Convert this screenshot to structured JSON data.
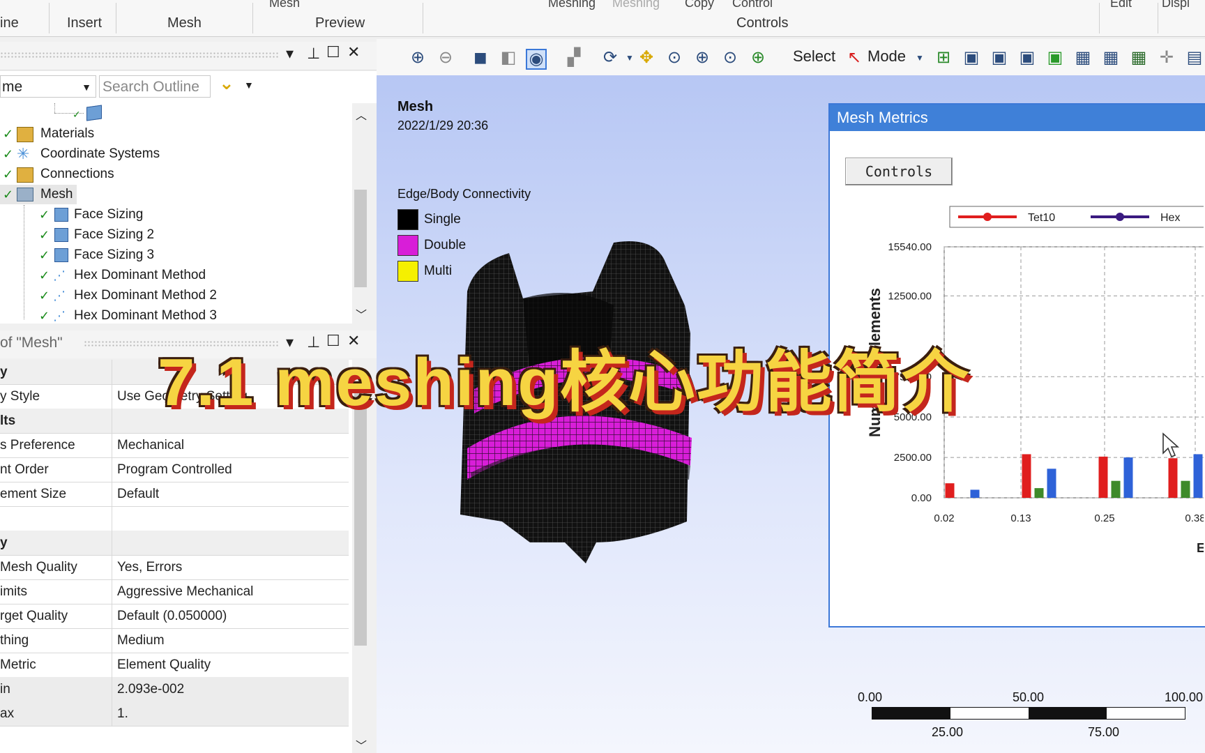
{
  "ribbon": {
    "top_labels": [
      "Mesh",
      "Meshing",
      "Meshing",
      "Copy",
      "Control",
      "Edit",
      "Displ"
    ],
    "groups": [
      "ine",
      "Insert",
      "Mesh",
      "Preview",
      "Controls"
    ]
  },
  "outline": {
    "combo_value": "me",
    "search_placeholder": "Search Outline",
    "items": [
      {
        "label": "Materials"
      },
      {
        "label": "Coordinate Systems"
      },
      {
        "label": "Connections"
      },
      {
        "label": "Mesh"
      },
      {
        "label": "Face Sizing"
      },
      {
        "label": "Face Sizing 2"
      },
      {
        "label": "Face Sizing 3"
      },
      {
        "label": "Hex Dominant Method"
      },
      {
        "label": "Hex Dominant Method 2"
      },
      {
        "label": "Hex Dominant Method 3"
      }
    ]
  },
  "details": {
    "title": "of \"Mesh\"",
    "rows": [
      {
        "key": "y",
        "value": "",
        "type": "category"
      },
      {
        "key": "y Style",
        "value": "Use Geometry Setting",
        "type": "row"
      },
      {
        "key": "lts",
        "value": "",
        "type": "category"
      },
      {
        "key": "s Preference",
        "value": "Mechanical",
        "type": "row"
      },
      {
        "key": "nt Order",
        "value": "Program Controlled",
        "type": "row"
      },
      {
        "key": "ement Size",
        "value": "Default",
        "type": "row"
      },
      {
        "key": "",
        "value": "",
        "type": "row"
      },
      {
        "key": "y",
        "value": "",
        "type": "category"
      },
      {
        "key": "Mesh Quality",
        "value": "Yes, Errors",
        "type": "row"
      },
      {
        "key": "imits",
        "value": "Aggressive Mechanical",
        "type": "row"
      },
      {
        "key": "rget Quality",
        "value": "Default (0.050000)",
        "type": "row"
      },
      {
        "key": "thing",
        "value": "Medium",
        "type": "row"
      },
      {
        "key": "Metric",
        "value": "Element Quality",
        "type": "row"
      },
      {
        "key": "in",
        "value": "2.093e-002",
        "type": "readonly"
      },
      {
        "key": "ax",
        "value": "1.",
        "type": "readonly"
      }
    ]
  },
  "toolbar": {
    "select_label": "Select",
    "mode_label": "Mode"
  },
  "viewport": {
    "title": "Mesh",
    "timestamp": "2022/1/29 20:36",
    "legend_title": "Edge/Body Connectivity",
    "legend": [
      {
        "label": "Single",
        "color": "#000000"
      },
      {
        "label": "Double",
        "color": "#d81ed8"
      },
      {
        "label": "Multi",
        "color": "#f5f000"
      }
    ],
    "scale_top": [
      "0.00",
      "50.00",
      "100.00"
    ],
    "scale_bottom": [
      "25.00",
      "75.00"
    ]
  },
  "metrics": {
    "title": "Mesh Metrics",
    "controls_label": "Controls"
  },
  "chart_data": {
    "type": "bar",
    "title": "",
    "xlabel": "E",
    "ylabel": "Number of Elements",
    "legend": [
      {
        "name": "Tet10",
        "color": "#e01e1e"
      },
      {
        "name": "Hex",
        "color": "#3a1a80"
      }
    ],
    "y_ticks": [
      "0.00",
      "2500.00",
      "5000.00",
      "7500.00",
      "12500.00",
      "15540.00"
    ],
    "x_ticks": [
      "0.02",
      "0.13",
      "0.25",
      "0.38"
    ],
    "ylim": [
      0,
      15540
    ],
    "xlim": [
      0.02,
      0.4
    ],
    "grid": true,
    "groups": [
      {
        "x": 0.05,
        "red": 900,
        "green": 0,
        "blue": 500
      },
      {
        "x": 0.16,
        "red": 2700,
        "green": 600,
        "blue": 1800
      },
      {
        "x": 0.27,
        "red": 2550,
        "green": 1050,
        "blue": 2500
      },
      {
        "x": 0.37,
        "red": 2450,
        "green": 1050,
        "blue": 2700
      }
    ],
    "colors": {
      "red": "#e01e1e",
      "green": "#3e8a2a",
      "blue": "#2e62d8"
    }
  },
  "overlay": {
    "headline": "7.1  meshing核心功能简介"
  }
}
